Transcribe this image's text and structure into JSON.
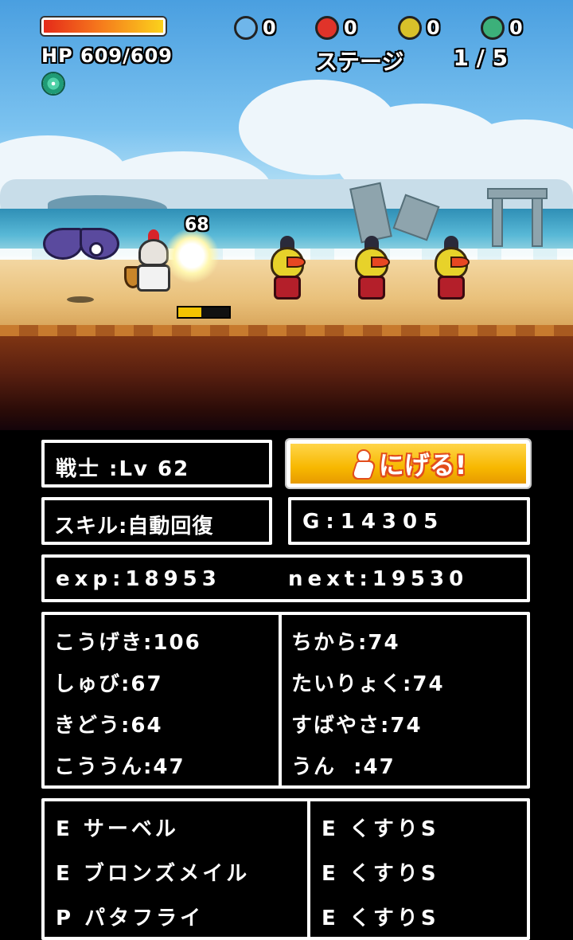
{
  "hud": {
    "hp_label": "HP 609/609",
    "hp_fraction": 1.0,
    "orbs": [
      {
        "icon": "blue-drop-orb-icon",
        "color": "#6fb6ea",
        "count": "0"
      },
      {
        "icon": "red-sword-orb-icon",
        "color": "#e0332a",
        "count": "0"
      },
      {
        "icon": "yellow-shield-orb-icon",
        "color": "#d8c12a",
        "count": "0"
      },
      {
        "icon": "green-potion-orb-icon",
        "color": "#3cb07a",
        "count": "0"
      }
    ],
    "stage_label": "ステージ",
    "stage_value": "1 / 5"
  },
  "battle": {
    "damage_number": "68",
    "attack_gauge": 0.45
  },
  "status": {
    "class_level": "戦士 :Lv 62",
    "flee_button": "にげる!",
    "skill": "スキル:自動回復",
    "gold": "G:14305",
    "exp": "exp:18953",
    "next": "next:19530"
  },
  "stats_left": [
    "こうげき:106",
    "しゅび:67",
    "きどう:64",
    "こううん:47"
  ],
  "stats_right": [
    "ちから:74",
    "たいりょく:74",
    "すばやさ:74",
    "うん  :47"
  ],
  "equipment_left": [
    "E サーベル",
    "E ブロンズメイル",
    "P パタフライ"
  ],
  "equipment_right": [
    "E くすりS",
    "E くすりS",
    "E くすりS"
  ]
}
